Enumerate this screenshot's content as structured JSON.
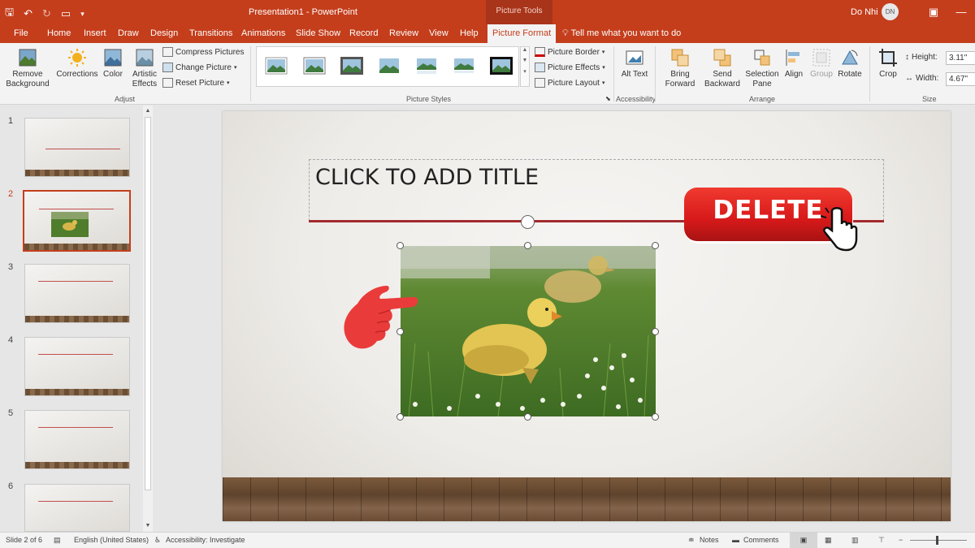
{
  "window": {
    "title": "Presentation1  -  PowerPoint",
    "context_group": "Picture Tools",
    "user_name": "Do Nhi",
    "user_initials": "DN"
  },
  "tabs": [
    {
      "label": "File"
    },
    {
      "label": "Home"
    },
    {
      "label": "Insert"
    },
    {
      "label": "Draw"
    },
    {
      "label": "Design"
    },
    {
      "label": "Transitions"
    },
    {
      "label": "Animations"
    },
    {
      "label": "Slide Show"
    },
    {
      "label": "Record"
    },
    {
      "label": "Review"
    },
    {
      "label": "View"
    },
    {
      "label": "Help"
    },
    {
      "label": "Picture Format",
      "active": true
    }
  ],
  "tell_me": "Tell me what you want to do",
  "ribbon": {
    "adjust": {
      "remove_background": "Remove Background",
      "corrections": "Corrections",
      "color": "Color",
      "artistic_effects": "Artistic Effects",
      "compress_pictures": "Compress Pictures",
      "change_picture": "Change Picture",
      "reset_picture": "Reset Picture",
      "label": "Adjust"
    },
    "picture_styles": {
      "picture_border": "Picture Border",
      "picture_effects": "Picture Effects",
      "picture_layout": "Picture Layout",
      "label": "Picture Styles"
    },
    "accessibility": {
      "alt_text": "Alt Text",
      "label": "Accessibility"
    },
    "arrange": {
      "bring_forward": "Bring Forward",
      "send_backward": "Send Backward",
      "selection_pane": "Selection Pane",
      "align": "Align",
      "group": "Group",
      "rotate": "Rotate",
      "label": "Arrange"
    },
    "size": {
      "crop": "Crop",
      "height_label": "Height:",
      "height_value": "3.11\"",
      "width_label": "Width:",
      "width_value": "4.67\"",
      "label": "Size"
    }
  },
  "slides": [
    {
      "number": "1"
    },
    {
      "number": "2",
      "selected": true
    },
    {
      "number": "3"
    },
    {
      "number": "4"
    },
    {
      "number": "5"
    },
    {
      "number": "6"
    }
  ],
  "slide": {
    "title_placeholder": "CLICK TO ADD TITLE"
  },
  "overlay": {
    "delete_label": "DELETE"
  },
  "status": {
    "slide_info": "Slide 2 of 6",
    "language": "English (United States)",
    "accessibility": "Accessibility: Investigate",
    "notes": "Notes",
    "comments": "Comments"
  },
  "colors": {
    "accent": "#c43e1c",
    "title_rule": "#a32a2e",
    "delete_red": "#e0201e"
  }
}
